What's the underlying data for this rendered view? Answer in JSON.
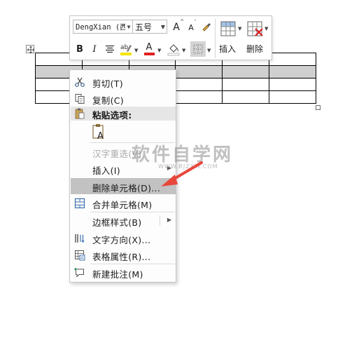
{
  "toolbar": {
    "font_name": "DengXian (西",
    "font_size": "五号",
    "grow_font_glyph": "A",
    "shrink_font_glyph": "A",
    "bold_glyph": "B",
    "italic_glyph": "I",
    "font_color_glyph": "A",
    "insert_label": "插入",
    "delete_label": "删除",
    "colors": {
      "highlight": "#f5e500",
      "font_color": "#e02020"
    }
  },
  "context_menu": {
    "items": [
      {
        "label": "剪切(T)",
        "icon": "scissors-icon"
      },
      {
        "label": "复制(C)",
        "icon": "copy-icon"
      },
      {
        "label": "粘贴选项:",
        "icon": "paste-icon"
      },
      {
        "label": "汉字重选(V)",
        "icon": ""
      },
      {
        "label": "插入(I)",
        "icon": ""
      },
      {
        "label": "删除单元格(D)...",
        "icon": ""
      },
      {
        "label": "合并单元格(M)",
        "icon": "merge-cells-icon"
      },
      {
        "label": "边框样式(B)",
        "icon": ""
      },
      {
        "label": "文字方向(X)...",
        "icon": "text-direction-icon"
      },
      {
        "label": "表格属性(R)...",
        "icon": "table-properties-icon"
      },
      {
        "label": "新建批注(M)",
        "icon": "new-comment-icon"
      }
    ],
    "paste_option_glyph": "A",
    "highlighted_color": "#c2c2c2"
  },
  "watermark": {
    "title": "软件自学网",
    "url": "WWW.RJZXW.COM"
  },
  "annotation": {
    "arrow_color": "#e8473c"
  }
}
